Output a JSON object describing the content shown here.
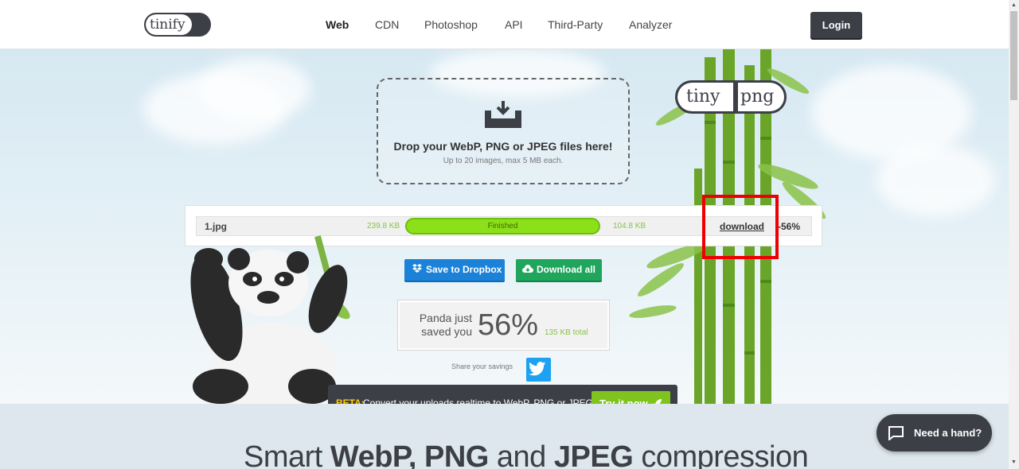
{
  "header": {
    "logo_text": "tinify",
    "nav": [
      {
        "label": "Web"
      },
      {
        "label": "CDN"
      },
      {
        "label": "Photoshop"
      },
      {
        "label": "API"
      },
      {
        "label": "Third-Party"
      },
      {
        "label": "Analyzer"
      }
    ],
    "login_label": "Login"
  },
  "dropzone": {
    "title": "Drop your WebP, PNG or JPEG files here!",
    "subtitle": "Up to 20 images, max 5 MB each."
  },
  "brand_logo": {
    "left": "tiny",
    "right": "png"
  },
  "result": {
    "filename": "1.jpg",
    "original_size": "239.8 KB",
    "status": "Finished",
    "progress": 1.0,
    "new_size": "104.8 KB",
    "download_label": "download",
    "reduction": "-56%"
  },
  "actions": {
    "dropbox_label": "Save to Dropbox",
    "download_all_label": "Download all"
  },
  "savings": {
    "line1": "Panda just",
    "line2": "saved you",
    "percent": "56%",
    "total": "135 KB total",
    "share_label": "Share your savings"
  },
  "beta": {
    "label": "BETA:",
    "text": "Convert your uploads realtime to WebP, PNG or JPEG",
    "button_label": "Try it now"
  },
  "section": {
    "headline_parts": [
      "Smart ",
      "WebP, PNG",
      " and ",
      "JPEG",
      " compression"
    ]
  },
  "help": {
    "label": "Need a hand?"
  },
  "colors": {
    "dark": "#3d3f47",
    "progress_green": "#8ce01a",
    "size_green": "#8ac34a",
    "dropbox_blue": "#1b82d8",
    "download_green": "#20a55c",
    "twitter_blue": "#1da1f2",
    "highlight_red": "#ee0000",
    "beta_yellow": "#ffcc00"
  },
  "icons": [
    "download-tray-icon",
    "dropbox-icon",
    "cloud-download-icon",
    "twitter-icon",
    "rocket-icon",
    "chat-bubble-icon"
  ]
}
